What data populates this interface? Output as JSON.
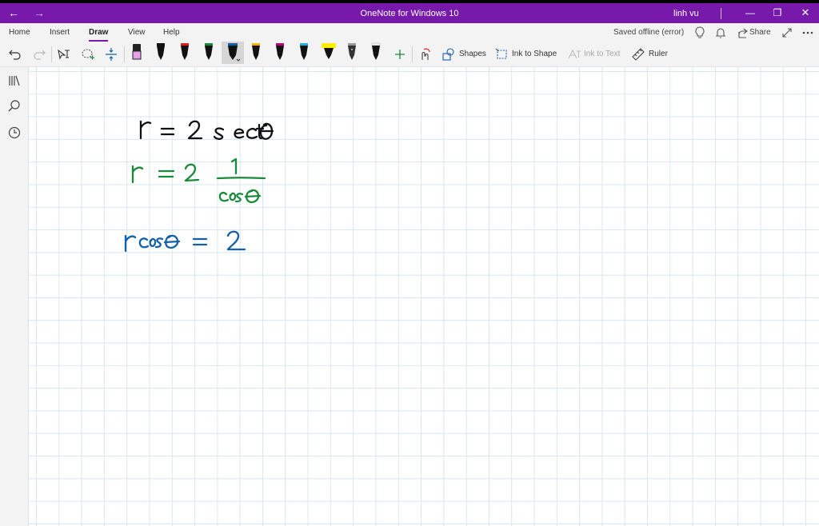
{
  "window": {
    "title": "OneNote for Windows 10",
    "user": "linh vu",
    "accent": "#7719aa"
  },
  "ribbon": {
    "tabs": [
      {
        "label": "Home"
      },
      {
        "label": "Insert"
      },
      {
        "label": "Draw",
        "active": true
      },
      {
        "label": "View"
      },
      {
        "label": "Help"
      }
    ],
    "status": "Saved offline (error)",
    "share_label": "Share"
  },
  "toolbar": {
    "shapes_label": "Shapes",
    "ink_to_shape_label": "Ink to Shape",
    "ink_to_text_label": "Ink to Text",
    "ruler_label": "Ruler",
    "pens": [
      {
        "name": "pink-highlighter",
        "color": "#e8a0e8"
      },
      {
        "name": "black-pen",
        "color": "#111111"
      },
      {
        "name": "red-pen",
        "color": "#e02020"
      },
      {
        "name": "green-pen",
        "color": "#1a8a3a"
      },
      {
        "name": "blue-pen",
        "color": "#1460a8",
        "selected": true
      },
      {
        "name": "yellow-pen",
        "color": "#f0b400"
      },
      {
        "name": "magenta-pen",
        "color": "#c0007a"
      },
      {
        "name": "cyan-pen",
        "color": "#20b0e0"
      },
      {
        "name": "yellow-highlighter",
        "color": "#ffee00"
      },
      {
        "name": "galaxy-pen",
        "color": "#444444"
      },
      {
        "name": "black-pen-2",
        "color": "#111111"
      }
    ]
  },
  "page": {
    "ink_lines": [
      {
        "text": "r = 2 secθ",
        "color": "#111111"
      },
      {
        "text": "r = 2 · 1/cosθ",
        "color": "#1a8a3a"
      },
      {
        "text": "r cosθ = 2",
        "color": "#1460a8"
      }
    ]
  }
}
